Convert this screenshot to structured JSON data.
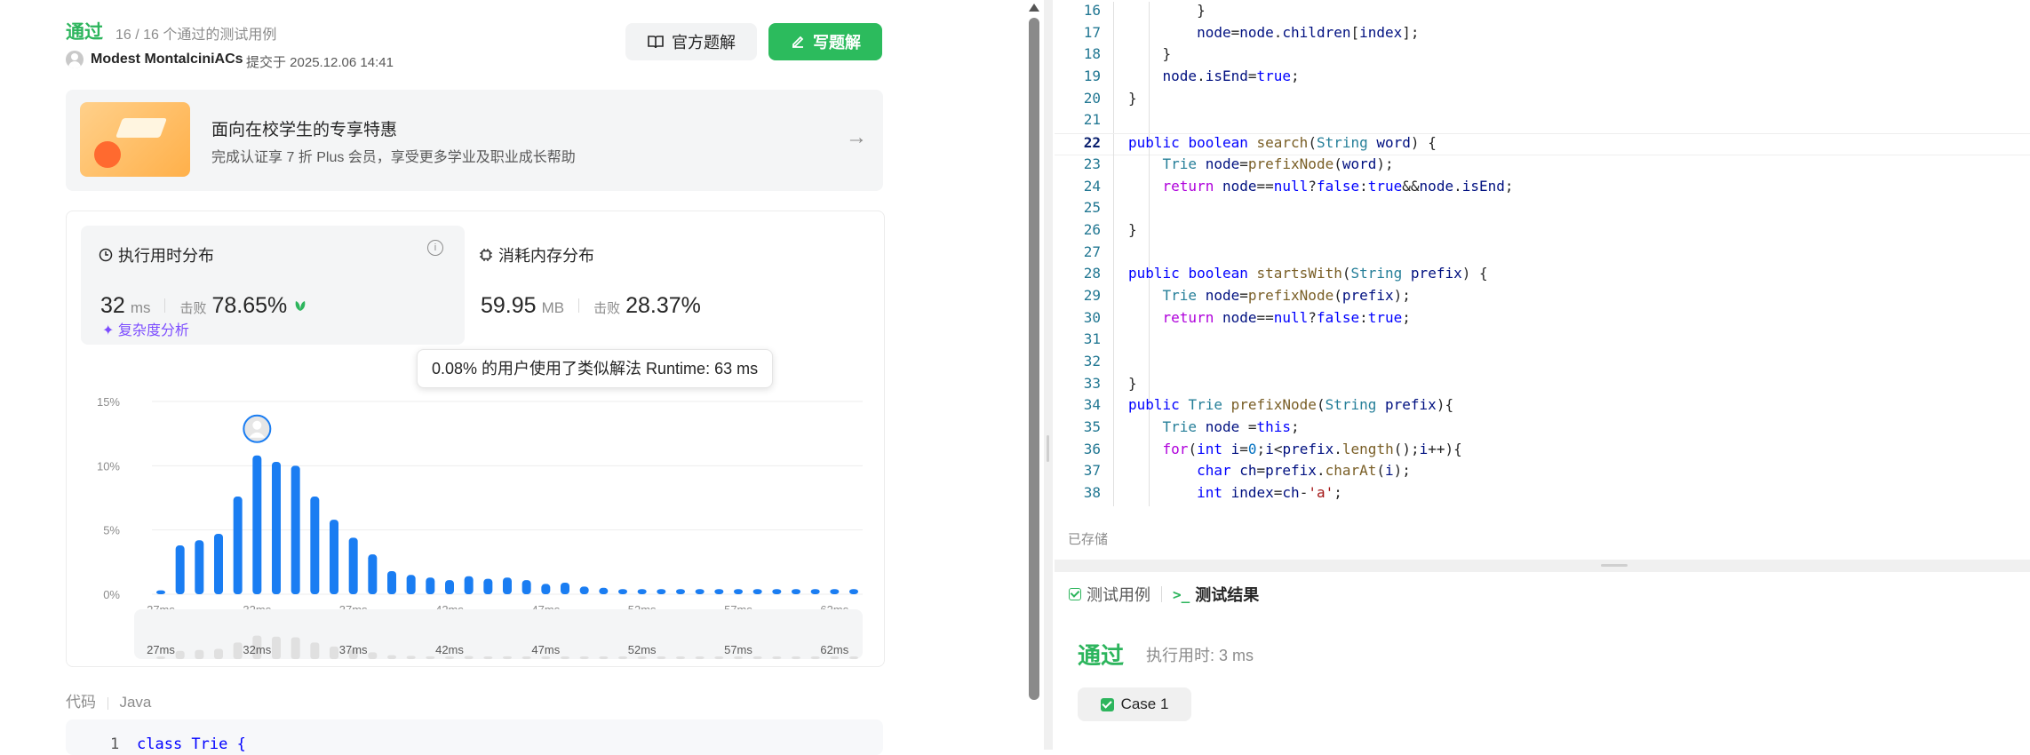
{
  "submission": {
    "status": "通过",
    "testcases": "16 / 16 个通过的测试用例",
    "user": "Modest MontalciniACs",
    "submitted": "提交于 2025.12.06 14:41",
    "official_btn": "官方题解",
    "write_btn": "写题解"
  },
  "promo": {
    "title": "面向在校学生的专享特惠",
    "subtitle": "完成认证享 7 折 Plus 会员，享受更多学业及职业成长帮助"
  },
  "runtime": {
    "title": "执行用时分布",
    "value": "32",
    "unit": "ms",
    "beat_label": "击败",
    "beat": "78.65%",
    "complexity": "复杂度分析"
  },
  "memory": {
    "title": "消耗内存分布",
    "value": "59.95",
    "unit": "MB",
    "beat_label": "击败",
    "beat": "28.37%"
  },
  "tooltip": "0.08% 的用户使用了类似解法 Runtime: 63 ms",
  "chart_data": {
    "type": "bar",
    "y_ticks": [
      "15%",
      "10%",
      "5%",
      "0%"
    ],
    "x_ticks": [
      "27ms",
      "32ms",
      "37ms",
      "42ms",
      "47ms",
      "52ms",
      "57ms",
      "62ms"
    ],
    "ylim": [
      0,
      15
    ],
    "x": [
      27,
      28,
      29,
      30,
      31,
      32,
      33,
      34,
      35,
      36,
      37,
      38,
      39,
      40,
      41,
      42,
      43,
      44,
      45,
      46,
      47,
      48,
      49,
      50,
      51,
      52,
      53,
      54,
      55,
      56,
      57,
      58,
      59,
      60,
      61,
      62,
      63
    ],
    "values": [
      0.3,
      3.8,
      4.2,
      4.7,
      7.6,
      10.8,
      10.3,
      10.0,
      7.6,
      5.8,
      4.4,
      3.1,
      1.8,
      1.5,
      1.3,
      1.1,
      1.4,
      1.2,
      1.3,
      1.1,
      0.8,
      0.9,
      0.6,
      0.5,
      0.4,
      0.4,
      0.4,
      0.4,
      0.4,
      0.4,
      0.4,
      0.4,
      0.4,
      0.4,
      0.4,
      0.4,
      0.4
    ],
    "selected_x": 32
  },
  "code_section": {
    "label": "代码",
    "lang": "Java",
    "first_line_num": "1",
    "first_line": "class Trie {"
  },
  "editor": {
    "current_line": "22",
    "saved": "已存储",
    "lines": [
      {
        "n": "16",
        "t": "        }"
      },
      {
        "n": "17",
        "t": "        node=node.children[index];"
      },
      {
        "n": "18",
        "t": "    }"
      },
      {
        "n": "19",
        "t": "    node.isEnd=true;"
      },
      {
        "n": "20",
        "t": "}"
      },
      {
        "n": "21",
        "t": ""
      },
      {
        "n": "22",
        "t": "public boolean search(String word) {"
      },
      {
        "n": "23",
        "t": "    Trie node=prefixNode(word);"
      },
      {
        "n": "24",
        "t": "    return node==null?false:true&&node.isEnd;"
      },
      {
        "n": "25",
        "t": ""
      },
      {
        "n": "26",
        "t": "}"
      },
      {
        "n": "27",
        "t": ""
      },
      {
        "n": "28",
        "t": "public boolean startsWith(String prefix) {"
      },
      {
        "n": "29",
        "t": "    Trie node=prefixNode(prefix);"
      },
      {
        "n": "30",
        "t": "    return node==null?false:true;"
      },
      {
        "n": "31",
        "t": ""
      },
      {
        "n": "32",
        "t": ""
      },
      {
        "n": "33",
        "t": "}"
      },
      {
        "n": "34",
        "t": "public Trie prefixNode(String prefix){"
      },
      {
        "n": "35",
        "t": "    Trie node =this;"
      },
      {
        "n": "36",
        "t": "    for(int i=0;i<prefix.length();i++){"
      },
      {
        "n": "37",
        "t": "        char ch=prefix.charAt(i);"
      },
      {
        "n": "38",
        "t": "        int index=ch-'a';"
      }
    ]
  },
  "result": {
    "tab_cases": "测试用例",
    "tab_result": "测试结果",
    "status": "通过",
    "runtime": "执行用时: 3 ms",
    "case": "Case 1"
  },
  "colors": {
    "accent_green": "#2cbb5d",
    "bar_blue": "#1a7df2",
    "purple": "#7c4dff"
  }
}
